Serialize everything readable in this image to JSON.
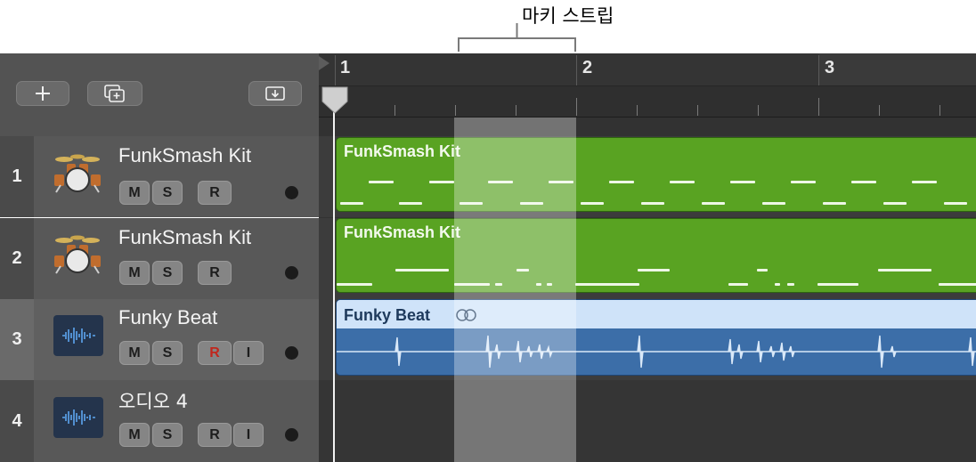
{
  "callout": {
    "label": "마키 스트립"
  },
  "header_buttons": [
    {
      "name": "add-track-button",
      "icon": "plus-icon"
    },
    {
      "name": "duplicate-track-button",
      "icon": "duplicate-icon"
    },
    {
      "name": "download-button",
      "icon": "download-icon"
    }
  ],
  "ruler": {
    "bars": [
      "1",
      "2",
      "3"
    ]
  },
  "tracks": [
    {
      "number": "1",
      "name": "FunkSmash Kit",
      "icon": "drum-kit-icon",
      "buttons": [
        "M",
        "S",
        "R"
      ]
    },
    {
      "number": "2",
      "name": "FunkSmash Kit",
      "icon": "drum-kit-icon",
      "buttons": [
        "M",
        "S",
        "R"
      ]
    },
    {
      "number": "3",
      "name": "Funky Beat",
      "icon": "audio-waveform-icon",
      "buttons": [
        "M",
        "S",
        "R",
        "I"
      ],
      "selected": true
    },
    {
      "number": "4",
      "name": "오디오 4",
      "icon": "audio-waveform-icon",
      "buttons": [
        "M",
        "S",
        "R",
        "I"
      ]
    }
  ],
  "regions": [
    {
      "name": "FunkSmash Kit",
      "color": "#59a322"
    },
    {
      "name": "FunkSmash Kit",
      "color": "#59a322"
    },
    {
      "name": "Funky Beat",
      "loop_icon": "loop-icon",
      "color": "#3c6ea8",
      "header_color": "#cfe3f9"
    }
  ],
  "colors": {
    "record_armed_r": "#c0271d",
    "playhead": "#f2f2f2"
  }
}
